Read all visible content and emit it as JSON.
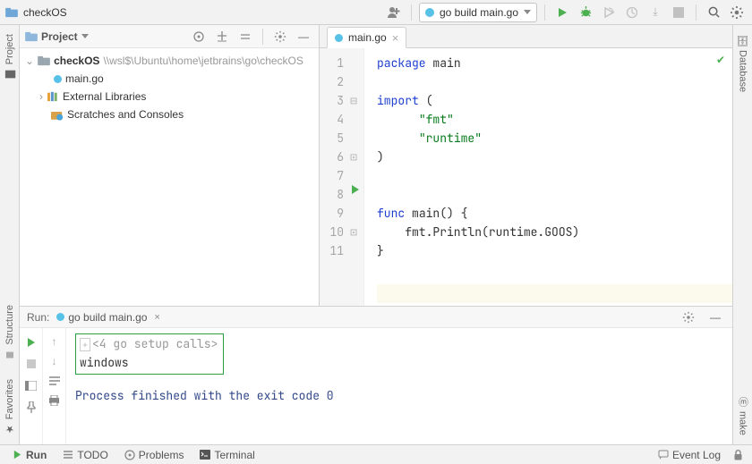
{
  "topbar": {
    "project_name": "checkOS",
    "run_config": "go build main.go"
  },
  "left_strip": {
    "project": "Project",
    "structure": "Structure",
    "favorites": "Favorites"
  },
  "right_strip": {
    "database": "Database",
    "make": "make"
  },
  "project_panel": {
    "title": "Project",
    "root": {
      "name": "checkOS",
      "path": "\\\\wsl$\\Ubuntu\\home\\jetbrains\\go\\checkOS"
    },
    "file_main": "main.go",
    "ext_libs": "External Libraries",
    "scratches": "Scratches and Consoles"
  },
  "editor": {
    "tab_name": "main.go",
    "lines": [
      {
        "n": 1,
        "tokens": [
          [
            "k",
            "package"
          ],
          [
            "",
            " "
          ],
          [
            "id",
            "main"
          ]
        ]
      },
      {
        "n": 2,
        "tokens": []
      },
      {
        "n": 3,
        "tokens": [
          [
            "k",
            "import"
          ],
          [
            "",
            " ("
          ]
        ],
        "fold": "minus"
      },
      {
        "n": 4,
        "tokens": [
          [
            "",
            "      "
          ],
          [
            "s",
            "\"fmt\""
          ]
        ]
      },
      {
        "n": 5,
        "tokens": [
          [
            "",
            "      "
          ],
          [
            "s",
            "\"runtime\""
          ]
        ]
      },
      {
        "n": 6,
        "tokens": [
          [
            "",
            ")"
          ]
        ],
        "fold_end": true
      },
      {
        "n": 7,
        "tokens": [],
        "caret": true
      },
      {
        "n": 8,
        "tokens": [
          [
            "k",
            "func"
          ],
          [
            "",
            " "
          ],
          [
            "id",
            "main"
          ],
          [
            "",
            "() {"
          ]
        ],
        "fold": "minus",
        "run": true
      },
      {
        "n": 9,
        "tokens": [
          [
            "",
            "    fmt."
          ],
          [
            "id",
            "Println"
          ],
          [
            "",
            "(runtime."
          ],
          [
            "id",
            "GOOS"
          ],
          [
            "",
            ")"
          ]
        ]
      },
      {
        "n": 10,
        "tokens": [
          [
            "",
            "}"
          ]
        ],
        "fold_end": true
      },
      {
        "n": 11,
        "tokens": []
      }
    ]
  },
  "run_panel": {
    "label": "Run:",
    "config": "go build main.go",
    "console_fold": "<4 go setup calls>",
    "console_out": "windows",
    "exit_msg": "Process finished with the exit code 0"
  },
  "status": {
    "run": "Run",
    "todo": "TODO",
    "problems": "Problems",
    "terminal": "Terminal",
    "event_log": "Event Log"
  }
}
